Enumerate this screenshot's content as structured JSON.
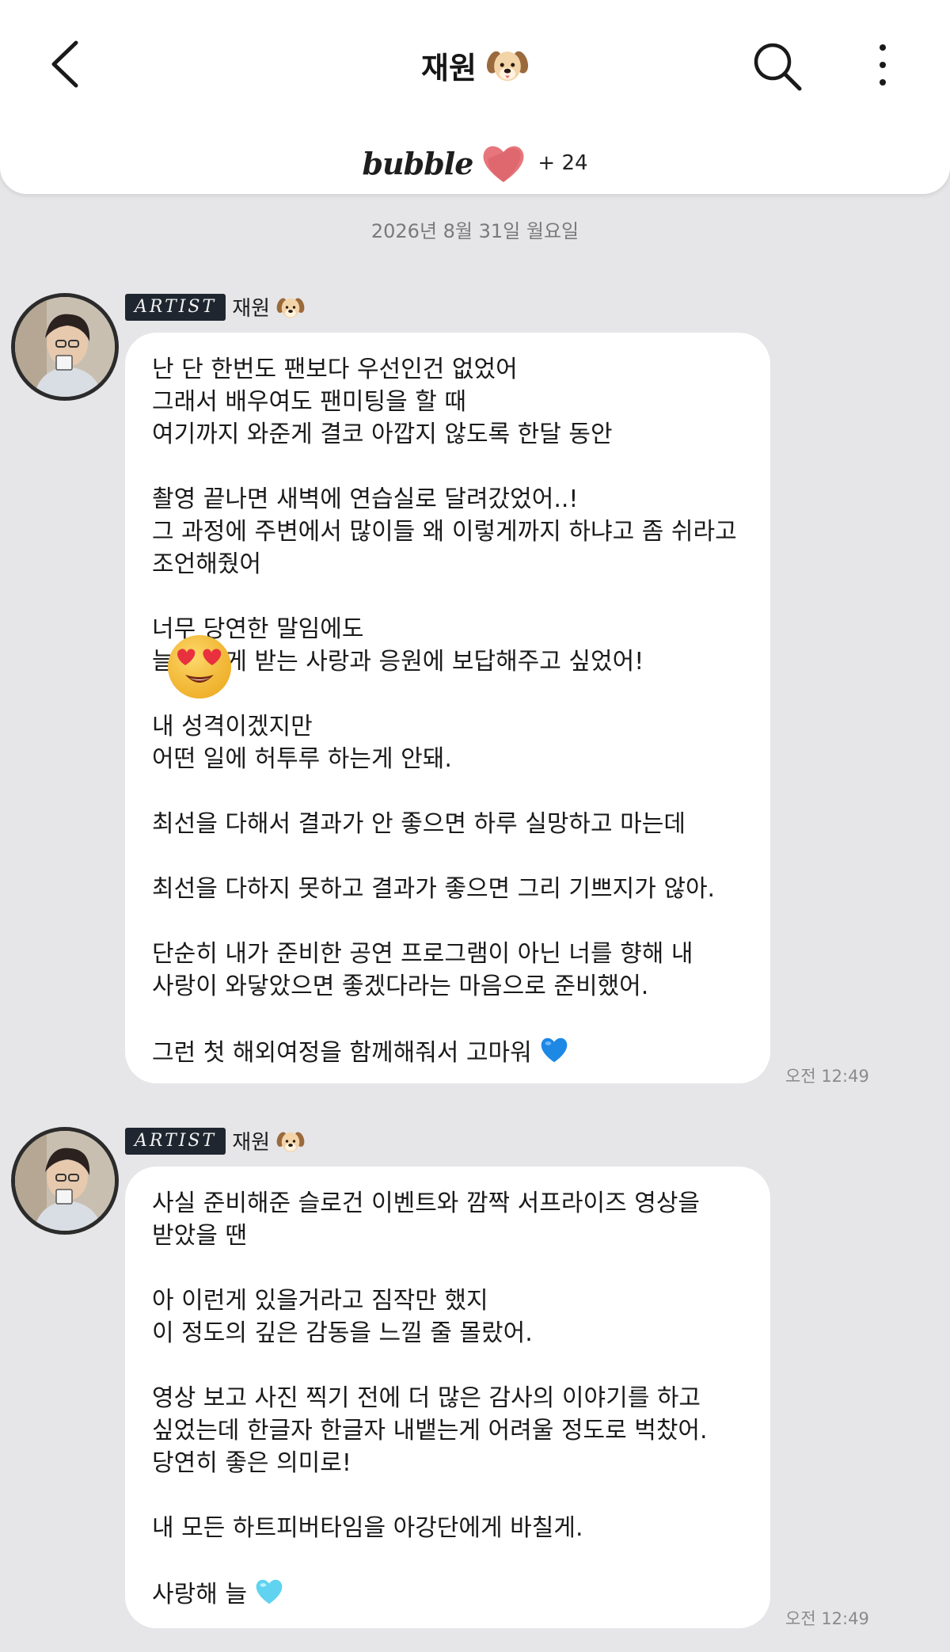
{
  "header": {
    "title": "재원",
    "brand": "bubble",
    "extra_count": "+ 24"
  },
  "date": "2026년 8월 31일 월요일",
  "messages": [
    {
      "badge": "ARTIST",
      "sender": "재원",
      "time": "오전 12:49",
      "lines": [
        "난 단 한번도 팬보다 우선인건 없었어",
        "그래서 배우여도 팬미팅을 할 때",
        "여기까지 와준게 결코 아깝지 않도록 한달 동안",
        "",
        "촬영 끝나면 새벽에 연습실로 달려갔었어..!",
        "그 과정에 주변에서 많이들 왜 이렇게까지 하냐고 좀 쉬라고",
        "조언해줬어",
        "",
        "너무 당연한 말임에도",
        "늘 너에게 받는 사랑과 응원에 보답해주고 싶었어!",
        "",
        "내 성격이겠지만",
        "어떤 일에 허투루 하는게 안돼.",
        "",
        "최선을 다해서 결과가 안 좋으면 하루 실망하고 마는데",
        "",
        "최선을 다하지 못하고 결과가 좋으면 그리 기쁘지가 않아.",
        "",
        "단순히 내가 준비한 공연 프로그램이 아닌 너를 향해 내",
        "사랑이 와닿았으면 좋겠다라는 마음으로 준비했어.",
        "",
        "그런 첫 해외여정을 함께해줘서 고마워"
      ],
      "end_emoji": "blue-heart"
    },
    {
      "badge": "ARTIST",
      "sender": "재원",
      "time": "오전 12:49",
      "lines": [
        "사실 준비해준 슬로건 이벤트와 깜짝 서프라이즈 영상을",
        "받았을 땐",
        "",
        "아 이런게 있을거라고 짐작만 했지",
        "이 정도의 깊은 감동을 느낄 줄 몰랐어.",
        "",
        "영상 보고 사진 찍기 전에 더 많은 감사의 이야기를 하고",
        "싶었는데 한글자 한글자 내뱉는게 어려울 정도로 벅찼어.",
        "당연히 좋은 의미로!",
        "",
        "내 모든 하트피버타임을 아강단에게 바칠게.",
        "",
        "사랑해 늘"
      ],
      "end_emoji": "light-blue-heart"
    }
  ],
  "colors": {
    "background": "#e6e6e8",
    "badge": "#1f2630",
    "blue_heart": "#1e88e5",
    "light_blue_heart": "#5fd3f0"
  }
}
